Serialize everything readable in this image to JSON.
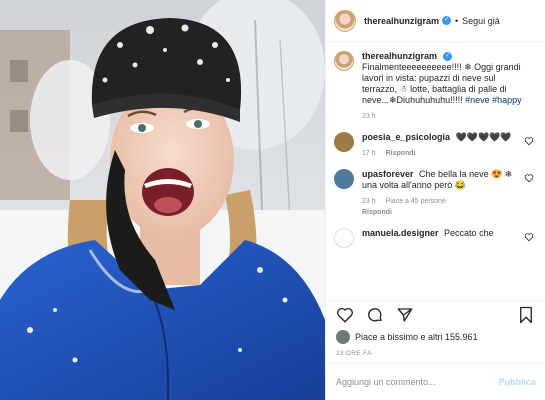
{
  "header": {
    "username": "therealhunzigram",
    "verified_badge": "✓",
    "separator": "•",
    "follow_label": "Segui già"
  },
  "caption": {
    "username": "therealhunzigram",
    "verified_badge": "✓",
    "text": "Finalmenteeeeeeeeee!!!! ❄ Oggi grandi lavori in vista: pupazzi di neve sul terrazzo, ☃ lotte, battaglia di palle di neve...❄Diuhuhuhuhu!!!!! ",
    "tags": [
      "#neve",
      "#happy"
    ],
    "time": "23 h"
  },
  "comments": [
    {
      "username": "poesia_e_psicologia",
      "text": "🖤🖤🖤🖤🖤",
      "time": "17 h",
      "reply_label": "Rispondi",
      "likes": ""
    },
    {
      "username": "upasforever",
      "text": "Che bella la neve 😍 ❄ una volta all'anno però 😂",
      "time": "23 h",
      "likes": "Piace a 45 persone",
      "reply_label": "Rispondi"
    },
    {
      "username": "manuela.designer",
      "text": "Peccato che",
      "time": "",
      "likes": "",
      "reply_label": ""
    }
  ],
  "actions": {
    "like_icon": "heart-outline-icon",
    "comment_icon": "comment-icon",
    "share_icon": "paper-plane-icon",
    "save_icon": "bookmark-icon"
  },
  "likes": {
    "text": "Piace a bissimo e altri 155.961"
  },
  "timestamp": "23 ORE FA",
  "add_comment": {
    "placeholder": "Aggiungi un commento...",
    "publish_label": "Pubblica"
  },
  "colors": {
    "accent_blue": "#3897f0",
    "publish_disabled": "#b2dffc",
    "muted_text": "#8e8e8e",
    "jacket_blue": "#1f4fb8"
  }
}
